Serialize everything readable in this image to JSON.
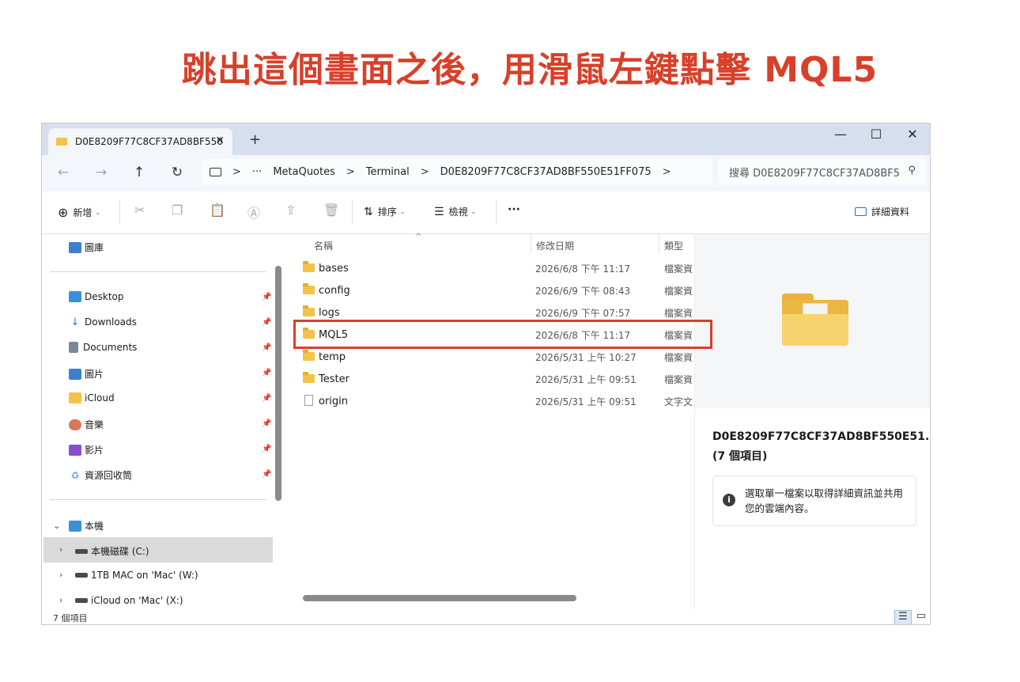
{
  "caption": "跳出這個畫面之後，用滑鼠左鍵點擊 MQL5",
  "window": {
    "tab_title": "D0E8209F77C8CF37AD8BF550",
    "tab_close": "✕",
    "new_tab": "+",
    "minimize": "—",
    "maximize": "☐",
    "close": "✕"
  },
  "nav": {
    "back": "←",
    "forward": "→",
    "up": "↑",
    "refresh": "↻",
    "more": "···"
  },
  "breadcrumb": {
    "items": [
      "MetaQuotes",
      "Terminal",
      "D0E8209F77C8CF37AD8BF550E51FF075"
    ],
    "separator": ">"
  },
  "search": {
    "placeholder": "搜尋 D0E8209F77C8CF37AD8BF5",
    "icon": "search-icon"
  },
  "toolbar": {
    "new_label": "新增",
    "sort_label": "排序",
    "view_label": "檢視",
    "more": "···",
    "details_label": "詳細資料"
  },
  "sidebar": {
    "gallery": "圖庫",
    "quick_access": [
      {
        "label": "Desktop",
        "icon": "desktop-icon",
        "color": "#3a8fd9"
      },
      {
        "label": "Downloads",
        "icon": "download-icon",
        "color": "#2a7bd3"
      },
      {
        "label": "Documents",
        "icon": "document-icon",
        "color": "#7a8899"
      },
      {
        "label": "圖片",
        "icon": "pictures-icon",
        "color": "#3f7fcf"
      },
      {
        "label": "iCloud",
        "icon": "folder-icon",
        "color": "#f3c348"
      },
      {
        "label": "音樂",
        "icon": "music-icon",
        "color": "#d9775a"
      },
      {
        "label": "影片",
        "icon": "video-icon",
        "color": "#8a4fcf"
      },
      {
        "label": "資源回收筒",
        "icon": "recycle-bin-icon",
        "color": "#6aa0d8"
      }
    ],
    "this_pc": "本機",
    "drives": [
      {
        "label": "本機磁碟 (C:)"
      },
      {
        "label": "1TB MAC on 'Mac' (W:)"
      },
      {
        "label": "iCloud on 'Mac' (X:)"
      }
    ]
  },
  "columns": {
    "name": "名稱",
    "date": "修改日期",
    "type": "類型"
  },
  "files": [
    {
      "name": "bases",
      "date": "2026/6/8 下午 11:17",
      "type": "檔案資",
      "kind": "folder"
    },
    {
      "name": "config",
      "date": "2026/6/9 下午 08:43",
      "type": "檔案資",
      "kind": "folder"
    },
    {
      "name": "logs",
      "date": "2026/6/9 下午 07:57",
      "type": "檔案資",
      "kind": "folder"
    },
    {
      "name": "MQL5",
      "date": "2026/6/8 下午 11:17",
      "type": "檔案資",
      "kind": "folder"
    },
    {
      "name": "temp",
      "date": "2026/5/31 上午 10:27",
      "type": "檔案資",
      "kind": "folder"
    },
    {
      "name": "Tester",
      "date": "2026/5/31 上午 09:51",
      "type": "檔案資",
      "kind": "folder"
    },
    {
      "name": "origin",
      "date": "2026/5/31 上午 09:51",
      "type": "文字文",
      "kind": "file"
    }
  ],
  "details": {
    "name": "D0E8209F77C8CF37AD8BF550E51...",
    "count": "(7 個項目)",
    "info_icon": "i",
    "info": "選取單一檔案以取得詳細資訊並共用您的雲端內容。"
  },
  "status": {
    "count": "7 個項目"
  }
}
